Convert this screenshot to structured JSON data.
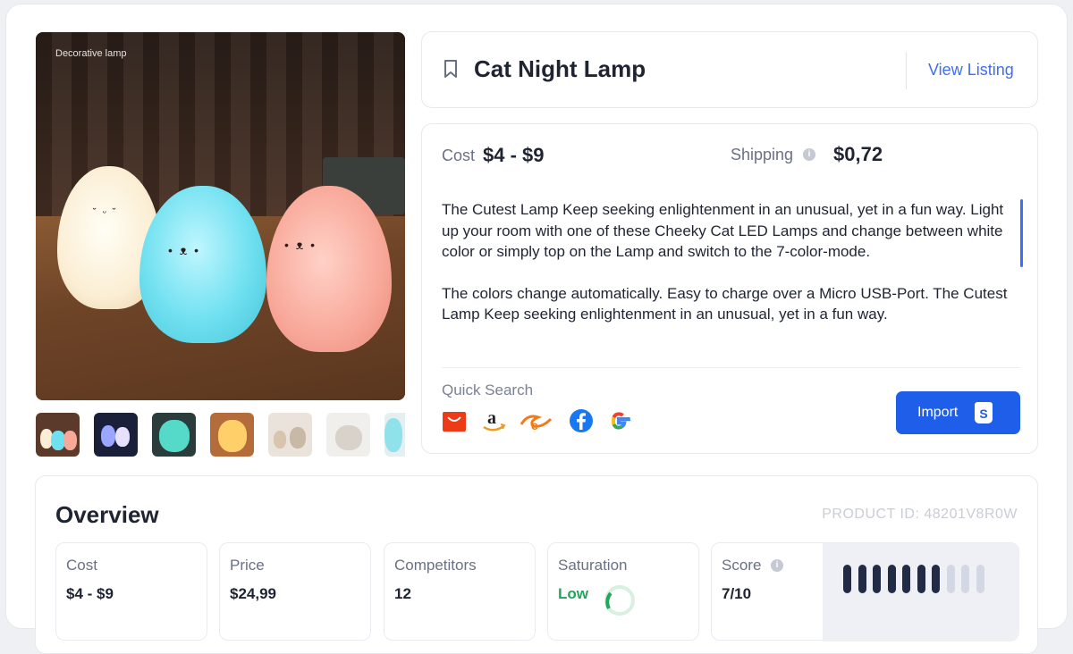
{
  "gallery": {
    "caption": "Decorative lamp",
    "thumbnails": [
      "thumb-1",
      "thumb-2",
      "thumb-3",
      "thumb-4",
      "thumb-5",
      "thumb-6",
      "thumb-7"
    ]
  },
  "product": {
    "title": "Cat Night Lamp",
    "view_listing": "View Listing",
    "cost_label": "Cost",
    "cost_value": "$4 - $9",
    "shipping_label": "Shipping",
    "shipping_value": "$0,72",
    "description": [
      "The Cutest Lamp Keep seeking enlightenment in an unusual, yet in a fun way. Light up your room with one of these Cheeky Cat LED Lamps and change between white color or simply top on the Lamp and switch to the 7-color-mode.",
      "The colors change automatically. Easy to charge over a Micro USB-Port. The Cutest Lamp Keep seeking enlightenment in an unusual, yet in a fun way."
    ],
    "quick_search_label": "Quick Search",
    "quick_search_icons": [
      "aliexpress-icon",
      "amazon-icon",
      "alibaba-icon",
      "facebook-icon",
      "google-icon"
    ],
    "import_label": "Import"
  },
  "overview": {
    "title": "Overview",
    "product_id": "PRODUCT ID: 48201V8R0W",
    "stats": [
      {
        "label": "Cost",
        "value": "$4 - $9"
      },
      {
        "label": "Price",
        "value": "$24,99"
      },
      {
        "label": "Competitors",
        "value": "12"
      },
      {
        "label": "Saturation",
        "value": "Low"
      },
      {
        "label": "Score",
        "value": "7/10"
      }
    ],
    "score_level": 7,
    "score_max": 10,
    "colors": {
      "accent": "#1f5ee8",
      "low": "#1fa75a",
      "bar_on": "#222b45",
      "bar_off": "#d3d8e4"
    }
  }
}
